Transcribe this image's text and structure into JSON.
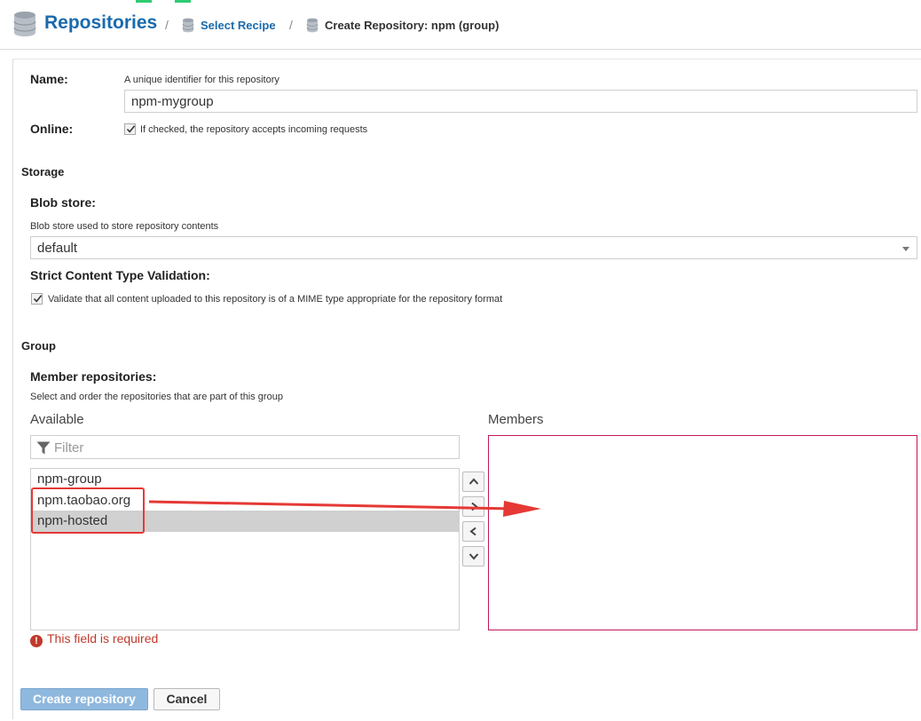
{
  "breadcrumb": {
    "title": "Repositories",
    "separator": "/",
    "link": "Select Recipe",
    "current": "Create Repository: npm (group)",
    "icon": "database-icon"
  },
  "form": {
    "name": {
      "label": "Name:",
      "help": "A unique identifier for this repository",
      "value": "npm-mygroup"
    },
    "online": {
      "label": "Online:",
      "checked": true,
      "text": "If checked, the repository accepts incoming requests"
    },
    "storage": {
      "section": "Storage",
      "blob_label": "Blob store:",
      "blob_help": "Blob store used to store repository contents",
      "blob_value": "default",
      "strict_label": "Strict Content Type Validation:",
      "strict_checked": true,
      "strict_text": "Validate that all content uploaded to this repository is of a MIME type appropriate for the repository format"
    },
    "group": {
      "section": "Group",
      "member_label": "Member repositories:",
      "member_help": "Select and order the repositories that are part of this group",
      "available_label": "Available",
      "members_label": "Members",
      "filter_placeholder": "Filter",
      "available": [
        "npm-group",
        "npm.taobao.org",
        "npm-hosted"
      ],
      "selected_item": "npm-hosted",
      "members": [],
      "error": "This field is required"
    }
  },
  "actions": {
    "create": "Create repository",
    "cancel": "Cancel"
  },
  "colors": {
    "brand": "#1a6aad",
    "accent": "#2ecc71",
    "error": "#c0392b",
    "members_border": "#c2185b",
    "annotation": "#e53935",
    "primary_button": "#8fb8de"
  }
}
